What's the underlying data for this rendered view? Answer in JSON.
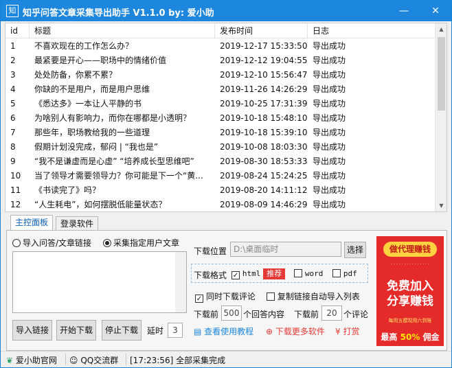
{
  "window": {
    "title": "知乎问答文章采集导出助手 V1.1.0  by: 爱小助",
    "icon_char": "知",
    "minimize": "—",
    "close": "✕"
  },
  "table": {
    "headers": [
      "id",
      "标题",
      "发布时间",
      "日志"
    ],
    "rows": [
      [
        "1",
        "不喜欢现在的工作怎么办？",
        "2019-12-17 15:33:50",
        "导出成功"
      ],
      [
        "2",
        "最紧要是开心——职场中的情绪价值",
        "2019-12-12 19:04:55",
        "导出成功"
      ],
      [
        "3",
        "处处防备，你累不累？",
        "2019-12-10 15:56:47",
        "导出成功"
      ],
      [
        "4",
        "你缺的不是用户，而是用户思维",
        "2019-11-26 14:26:29",
        "导出成功"
      ],
      [
        "5",
        "《悉达多》一本让人平静的书",
        "2019-10-25 17:31:39",
        "导出成功"
      ],
      [
        "6",
        "为啥别人有影响力，而你在哪都是小透明？",
        "2019-10-18 15:48:10",
        "导出成功"
      ],
      [
        "7",
        "那些年，职场教给我的一些道理",
        "2019-10-18 15:39:10",
        "导出成功"
      ],
      [
        "8",
        "假期计划没完成，郁闷 | “我也是”",
        "2019-10-08 18:03:30",
        "导出成功"
      ],
      [
        "9",
        " “我不是谦虚而是心虚” “培养成长型思维吧”",
        "2019-08-30 18:53:33",
        "导出成功"
      ],
      [
        "10",
        "当了领导才需要领导力？你可能是下一个“黄...",
        "2019-08-24 15:24:25",
        "导出成功"
      ],
      [
        "11",
        "《书读完了》吗？",
        "2019-08-20 14:11:12",
        "导出成功"
      ],
      [
        "12",
        " “人生耗电”，如何摆脱低能量状态？",
        "2019-08-09 14:46:29",
        "导出成功"
      ]
    ]
  },
  "tabs": {
    "main": "主控面板",
    "login": "登录软件"
  },
  "options": {
    "radio_import": "导入问答/文章链接",
    "radio_user": "采集指定用户文章",
    "selected": "radio_user"
  },
  "buttons": {
    "import": "导入链接",
    "start": "开始下载",
    "stop": "停止下载",
    "browse": "选择"
  },
  "delay": {
    "label": "延时",
    "value": "3"
  },
  "download": {
    "location_label": "下载位置",
    "location_value": "D:\\桌面临时",
    "format_label": "下载格式",
    "fmt_html": "html",
    "fmt_html_checked": true,
    "recommend": "推荐",
    "fmt_word": "word",
    "fmt_word_checked": false,
    "fmt_pdf": "pdf",
    "fmt_pdf_checked": false,
    "comments_label": "同时下载评论",
    "comments_checked": true,
    "autoimport_label": "复制链接自动导入列表",
    "autoimport_checked": false,
    "before_label1": "下载前",
    "answers_value": "500",
    "answers_label": "个回答内容",
    "before_label2": "下载前",
    "comments_value": "20",
    "comments_unit": "个评论"
  },
  "links": {
    "tutorial": "查看使用教程",
    "more": "下载更多软件",
    "tip": "打赏"
  },
  "ad": {
    "pill": "做代理赚钱",
    "line1": "免费加入",
    "line2": "分享赚钱",
    "strip": "每用五模现用六到账",
    "bottom_pre": "最高",
    "bottom_pct": "50%",
    "bottom_post": "佣金"
  },
  "status": {
    "official": "爱小助官网",
    "qq": "QQ交流群",
    "message": "[17:23:56]  全部采集完成"
  },
  "colors": {
    "titlebar": "#1c87dc",
    "accent": "#0a5fb4",
    "ad": "#e52a2a",
    "badge": "#e53935"
  }
}
